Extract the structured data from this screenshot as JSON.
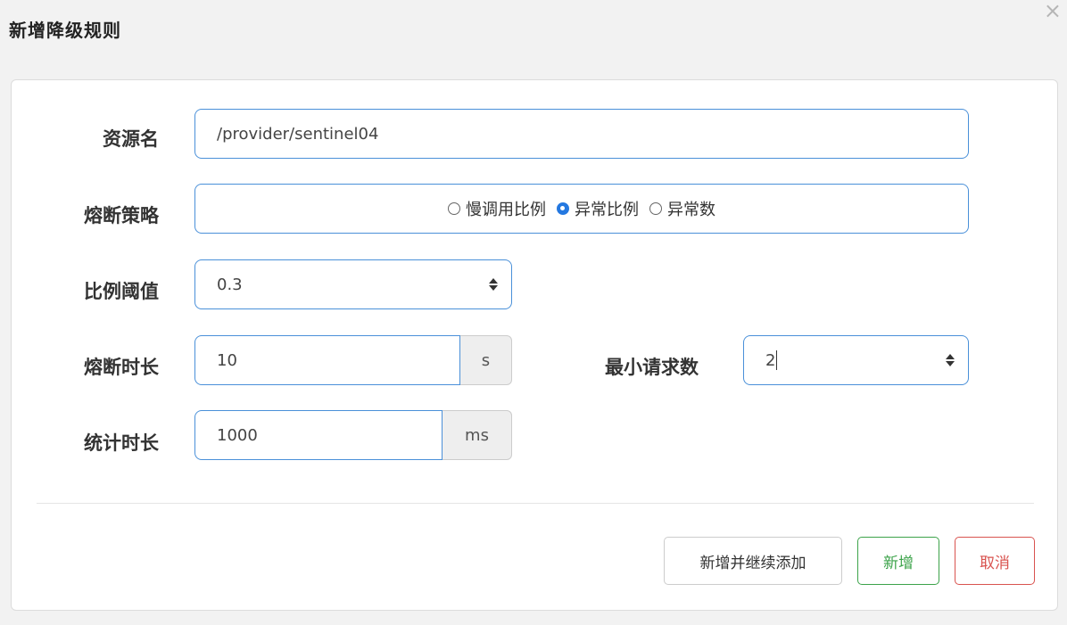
{
  "dialog": {
    "title": "新增降级规则",
    "close": "×"
  },
  "form": {
    "resource": {
      "label": "资源名",
      "value": "/provider/sentinel04"
    },
    "strategy": {
      "label": "熔断策略",
      "options": [
        "慢调用比例",
        "异常比例",
        "异常数"
      ],
      "selected": "异常比例"
    },
    "ratio_threshold": {
      "label": "比例阈值",
      "value": "0.3"
    },
    "break_duration": {
      "label": "熔断时长",
      "value": "10",
      "unit": "s"
    },
    "min_requests": {
      "label": "最小请求数",
      "value": "2"
    },
    "stat_duration": {
      "label": "统计时长",
      "value": "1000",
      "unit": "ms"
    }
  },
  "buttons": {
    "add_continue": "新增并继续添加",
    "add": "新增",
    "cancel": "取消"
  },
  "colors": {
    "input_border": "#4a90d9",
    "radio_checked": "#2478e0",
    "success": "#3ca34a",
    "danger": "#d9534f"
  }
}
